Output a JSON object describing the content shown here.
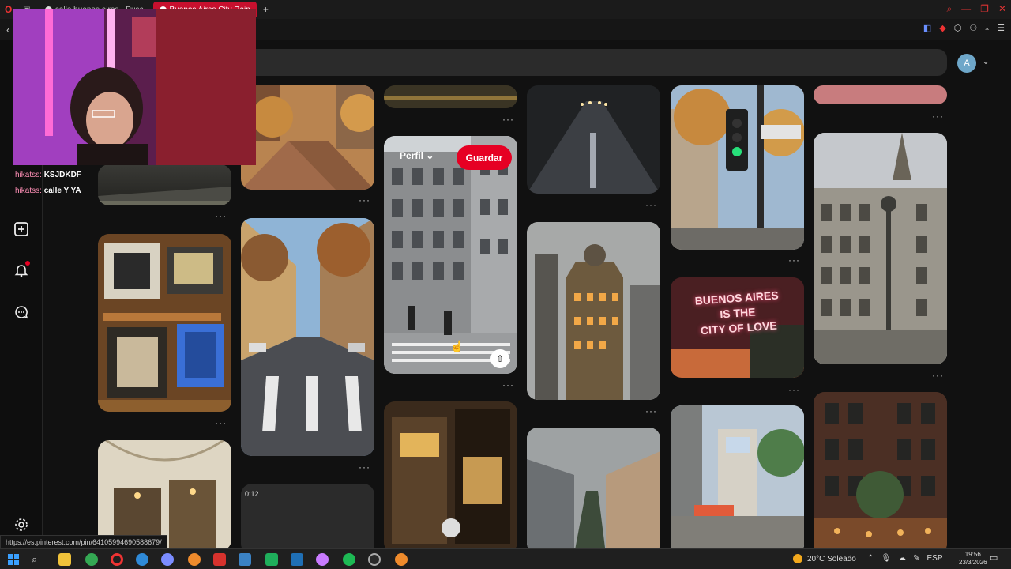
{
  "browser": {
    "tabs": [
      {
        "label": "calle buenos aires - Pusc"
      },
      {
        "label": "Buenos Aires City Rain"
      }
    ],
    "new_tab": "+"
  },
  "pinterest": {
    "account_initial": "A",
    "profile_label": "Perfil",
    "save_label": "Guardar",
    "video_duration": "0:12",
    "more_glyph": "···",
    "sign_lines": [
      "BUENOS AIRES",
      "IS THE",
      "CITY OF LOVE"
    ]
  },
  "stream_chat": [
    {
      "user": "hikatss:",
      "message": "KSJDKDF"
    },
    {
      "user": "hikatss:",
      "message": "calle Y YA"
    }
  ],
  "status_url": "https://es.pinterest.com/pin/641059946905886​79/",
  "taskbar": {
    "weather": "20°C  Soleado",
    "language": "ESP",
    "time": "19:56",
    "date": "23/3/2026"
  },
  "colors": {
    "accent": "#e60023",
    "background": "#111111"
  }
}
